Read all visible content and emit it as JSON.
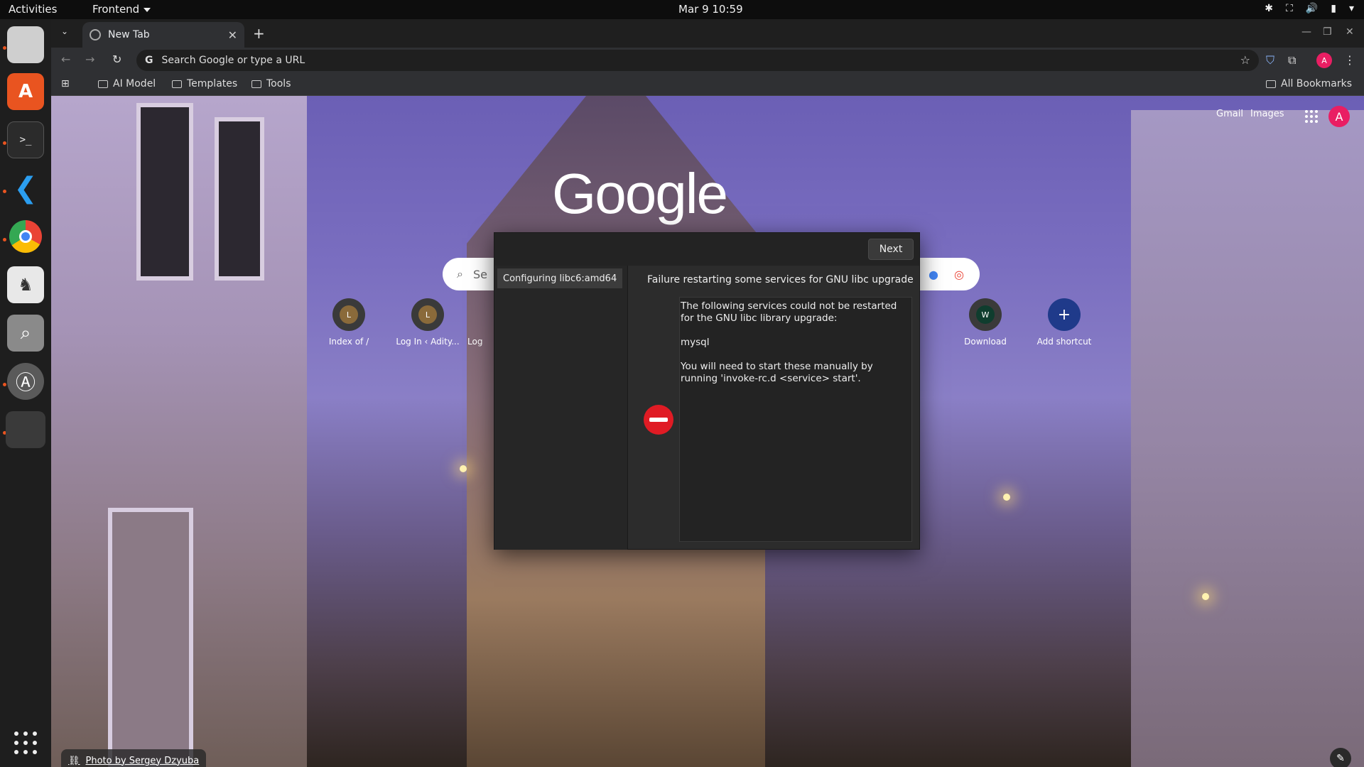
{
  "topbar": {
    "activities": "Activities",
    "app_menu": "Frontend",
    "clock": "Mar 9  10:59"
  },
  "dock": {
    "items": [
      "files-icon",
      "app-center-icon",
      "terminal-icon",
      "vscode-icon",
      "chrome-icon",
      "gimp-icon",
      "image-viewer-icon",
      "software-updater-icon",
      "blank-window-icon"
    ]
  },
  "browser": {
    "tab_title": "New Tab",
    "omnibox_placeholder": "Search Google or type a URL",
    "profile_initial": "A",
    "bookmarks": [
      "AI Model",
      "Templates",
      "Tools"
    ],
    "all_bookmarks": "All Bookmarks"
  },
  "newtab": {
    "logo": "Google",
    "gmail": "Gmail",
    "images": "Images",
    "avatar": "A",
    "search_placeholder": "Se",
    "shortcuts": [
      {
        "label": "Index of /",
        "initial": "L"
      },
      {
        "label": "Log In ‹ Adity...",
        "initial": "L"
      },
      {
        "label": "Log",
        "initial": ""
      },
      {
        "label": "Download",
        "initial": "W"
      },
      {
        "label": "Add shortcut",
        "initial": "+"
      }
    ],
    "photo_credit": "Photo by Sergey Dzyuba"
  },
  "dialog": {
    "next_label": "Next",
    "step": "Configuring libc6:amd64",
    "title": "Failure restarting some services for GNU libc upgrade",
    "para1": "The following services could not be restarted for the GNU libc library upgrade:",
    "para2": "mysql",
    "para3": "You will need to start these manually by running 'invoke-rc.d <service> start'."
  },
  "colors": {
    "accent": "#e95420",
    "error": "#e01b24",
    "avatar": "#e91e63"
  }
}
